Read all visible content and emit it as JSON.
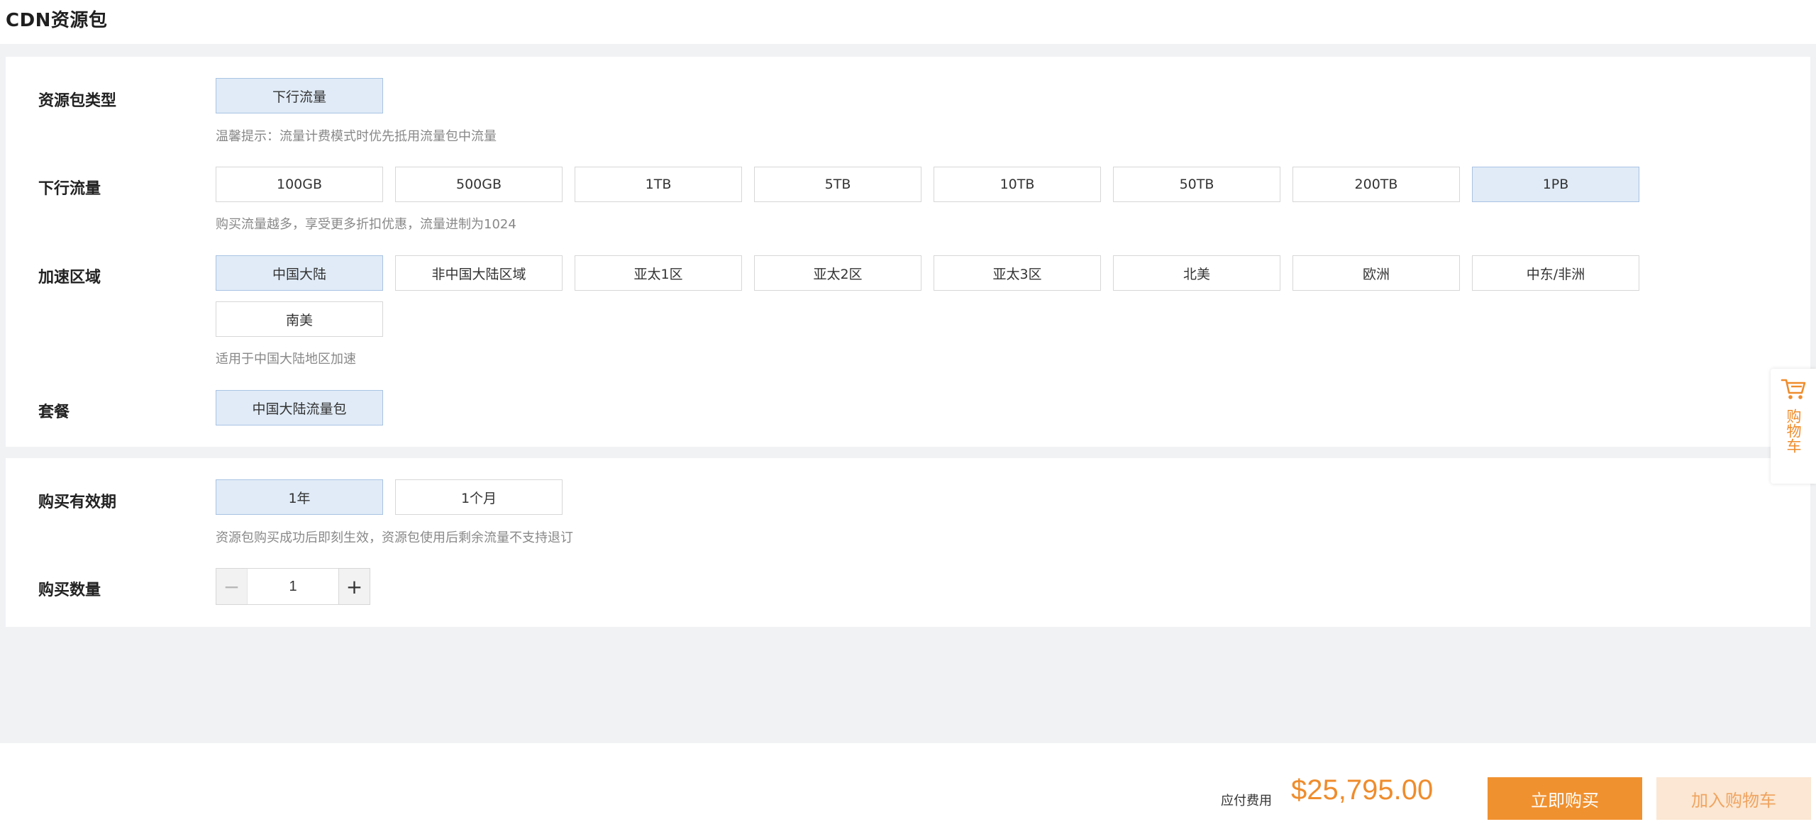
{
  "header": {
    "title": "CDN资源包"
  },
  "package_type": {
    "label": "资源包类型",
    "options": [
      "下行流量"
    ],
    "selected": "下行流量",
    "hint": "温馨提示：流量计费模式时优先抵用流量包中流量"
  },
  "traffic": {
    "label": "下行流量",
    "options": [
      "100GB",
      "500GB",
      "1TB",
      "5TB",
      "10TB",
      "50TB",
      "200TB",
      "1PB"
    ],
    "selected": "1PB",
    "hint": "购买流量越多，享受更多折扣优惠，流量进制为1024"
  },
  "region": {
    "label": "加速区域",
    "options": [
      "中国大陆",
      "非中国大陆区域",
      "亚太1区",
      "亚太2区",
      "亚太3区",
      "北美",
      "欧洲",
      "中东/非洲",
      "南美"
    ],
    "selected": "中国大陆",
    "hint": "适用于中国大陆地区加速"
  },
  "plan": {
    "label": "套餐",
    "options": [
      "中国大陆流量包"
    ],
    "selected": "中国大陆流量包"
  },
  "validity": {
    "label": "购买有效期",
    "options": [
      "1年",
      "1个月"
    ],
    "selected": "1年",
    "hint": "资源包购买成功后即刻生效，资源包使用后剩余流量不支持退订"
  },
  "quantity": {
    "label": "购买数量",
    "value": "1",
    "minus": "−",
    "plus": "+"
  },
  "side_cart": {
    "label": "购物车",
    "icon": "cart-icon"
  },
  "footer": {
    "fee_label": "应付费用",
    "price": "$25,795.00",
    "buy_now": "立即购买",
    "add_to_cart": "加入购物车"
  },
  "colors": {
    "accent": "#f0912f",
    "price": "#ef8c2c",
    "selected_bg": "#e0ebf7",
    "selected_border": "#a9c3e3"
  }
}
